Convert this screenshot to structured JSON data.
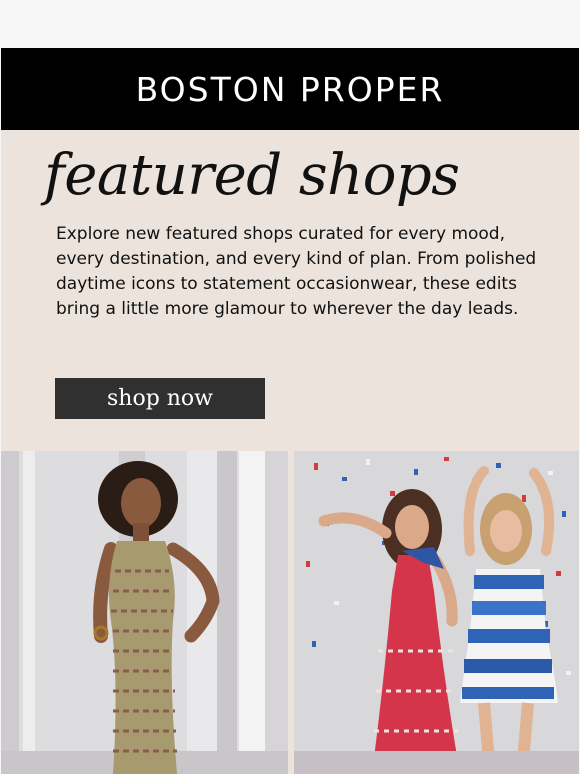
{
  "brand": {
    "name": "BOSTON PROPER"
  },
  "hero": {
    "title": "featured shops",
    "body": "Explore new featured shops curated for every mood, every destination, and every kind of plan. From polished daytime icons to statement occasionwear, these edits bring a little more glamour to wherever the day leads.",
    "cta_label": "shop now"
  },
  "colors": {
    "background": "#ece3dc",
    "header": "#000000",
    "button": "#303030"
  },
  "images": [
    {
      "name": "model-chevron-knit-dress"
    },
    {
      "name": "models-red-and-striped-dresses-confetti"
    }
  ]
}
